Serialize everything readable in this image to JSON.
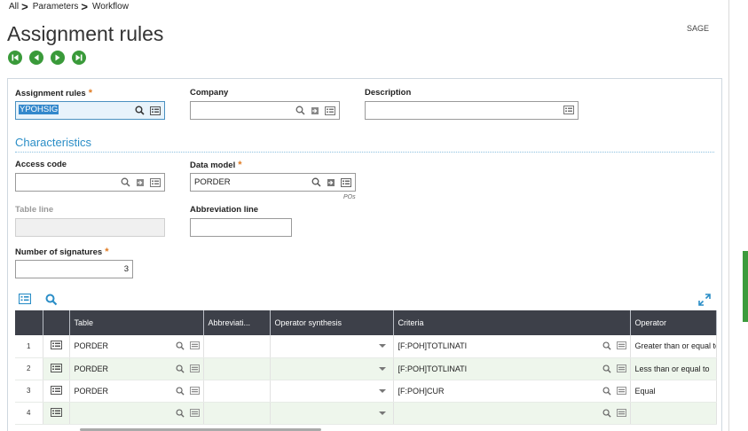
{
  "breadcrumb": [
    "All",
    "Parameters",
    "Workflow"
  ],
  "title": "Assignment rules",
  "brand": "SAGE",
  "colors": {
    "accent": "#2b8ec7",
    "nav_green": "#3a9a3a",
    "required": "#e07b22",
    "grid_header": "#3d4049"
  },
  "nav_buttons": [
    "first-record-icon",
    "previous-record-icon",
    "next-record-icon",
    "last-record-icon"
  ],
  "fields": {
    "assignment_rules": {
      "label": "Assignment rules",
      "value": "YPOHSIG"
    },
    "company": {
      "label": "Company",
      "value": ""
    },
    "description": {
      "label": "Description",
      "value": ""
    },
    "section": "Characteristics",
    "access_code": {
      "label": "Access code",
      "value": ""
    },
    "data_model": {
      "label": "Data model",
      "value": "PORDER",
      "sub": "POs"
    },
    "table_line": {
      "label": "Table line",
      "value": ""
    },
    "abbreviation_line": {
      "label": "Abbreviation line",
      "value": ""
    },
    "number_of_signatures": {
      "label": "Number of signatures",
      "value": "3"
    }
  },
  "grid": {
    "columns": [
      "Table",
      "Abbreviati...",
      "Operator synthesis",
      "Criteria",
      "Operator"
    ],
    "rows": [
      {
        "num": "1",
        "table": "PORDER",
        "abbrev": "",
        "synth": "",
        "criteria": "[F:POH]TOTLINATI",
        "operator": "Greater than or equal to"
      },
      {
        "num": "2",
        "table": "PORDER",
        "abbrev": "",
        "synth": "",
        "criteria": "[F:POH]TOTLINATI",
        "operator": "Less than or equal to"
      },
      {
        "num": "3",
        "table": "PORDER",
        "abbrev": "",
        "synth": "",
        "criteria": "[F:POH]CUR",
        "operator": "Equal"
      },
      {
        "num": "4",
        "table": "",
        "abbrev": "",
        "synth": "",
        "criteria": "",
        "operator": ""
      }
    ]
  }
}
